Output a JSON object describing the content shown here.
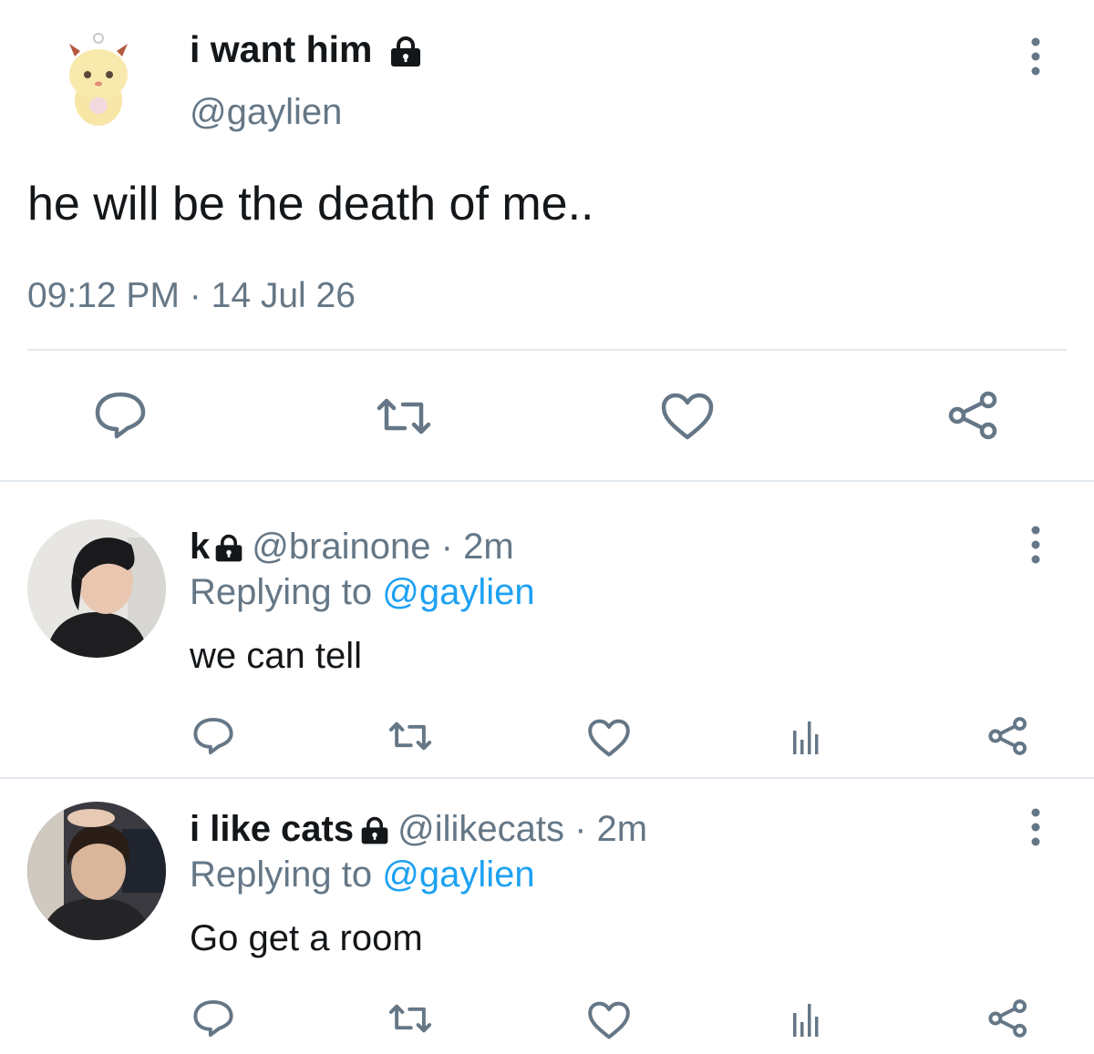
{
  "main_tweet": {
    "display_name": "i want him",
    "handle": "@gaylien",
    "text": "he will be the death of me..",
    "time": "09:12 PM",
    "separator": "·",
    "date": "14 Jul 26",
    "icons": [
      "avatar-plush-image",
      "lock-icon",
      "more-options-icon",
      "reply-icon",
      "retweet-icon",
      "like-icon",
      "share-icon"
    ]
  },
  "replies": [
    {
      "display_name": "k",
      "handle": "@brainone",
      "meta": "· 2m",
      "replying_prefix": "Replying to",
      "replying_handle": "@gaylien",
      "text": "we can tell"
    },
    {
      "display_name": "i like cats",
      "handle": "@ilikecats",
      "meta": "· 2m",
      "replying_prefix": "Replying to",
      "replying_handle": "@gaylien",
      "text": "Go get a room"
    }
  ],
  "colors": {
    "text": "#14171a",
    "secondary": "#657786",
    "link": "#1da1f2",
    "divider": "#e1e8ed"
  }
}
